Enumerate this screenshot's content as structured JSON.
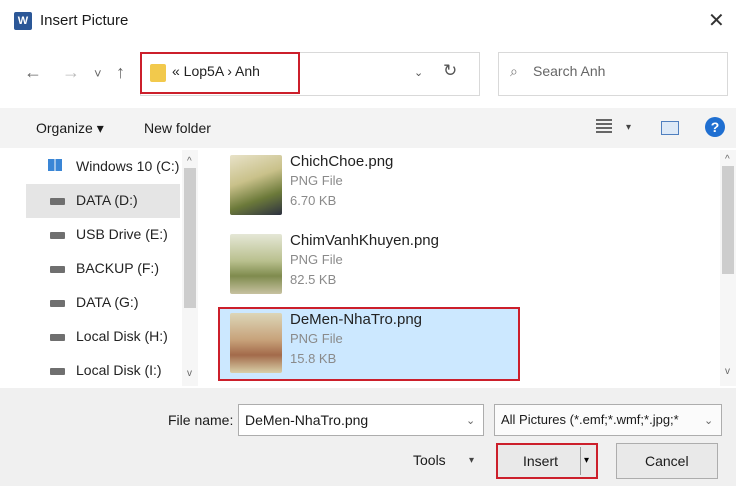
{
  "window": {
    "title": "Insert Picture",
    "app_icon_text": "W",
    "close_glyph": "✕"
  },
  "nav_buttons": {
    "back": "←",
    "forward": "→",
    "recent": "˅",
    "up": "↑"
  },
  "address": {
    "path": "« Lop5A › Anh",
    "dropdown_glyph": "⌄",
    "refresh_glyph": "↻"
  },
  "search": {
    "icon": "⌕",
    "placeholder": "Search Anh"
  },
  "toolbar": {
    "organize": "Organize ▾",
    "new_folder": "New folder",
    "view_dropdown": "▾",
    "help": "?"
  },
  "nav_pane": {
    "items": [
      {
        "label": "Windows 10 (C:)",
        "icon": "windows-drive-icon"
      },
      {
        "label": "DATA (D:)",
        "icon": "drive-icon",
        "selected": true
      },
      {
        "label": "USB Drive (E:)",
        "icon": "drive-icon"
      },
      {
        "label": "BACKUP (F:)",
        "icon": "drive-icon"
      },
      {
        "label": "DATA (G:)",
        "icon": "drive-icon"
      },
      {
        "label": "Local Disk (H:)",
        "icon": "drive-icon"
      },
      {
        "label": "Local Disk (I:)",
        "icon": "drive-icon"
      }
    ],
    "expand_glyph": "^",
    "collapse_glyph": "v"
  },
  "files": [
    {
      "name": "ChichChoe.png",
      "type": "PNG File",
      "size": "6.70 KB"
    },
    {
      "name": "ChimVanhKhuyen.png",
      "type": "PNG File",
      "size": "82.5 KB"
    },
    {
      "name": "DeMen-NhaTro.png",
      "type": "PNG File",
      "size": "15.8 KB",
      "selected": true
    }
  ],
  "scroll": {
    "up": "^",
    "down": "v"
  },
  "bottom": {
    "file_name_label": "File name:",
    "file_name_value": "DeMen-NhaTro.png",
    "file_type_value": "All Pictures (*.emf;*.wmf;*.jpg;*",
    "dropdown_glyph": "⌄",
    "tools": "Tools",
    "tools_dropdown": "▾",
    "insert": "Insert",
    "insert_arrow": "▾",
    "cancel": "Cancel"
  },
  "colors": {
    "highlight_border": "#cc1f2b",
    "selection": "#cce8ff",
    "help_blue": "#1f6fd1"
  }
}
